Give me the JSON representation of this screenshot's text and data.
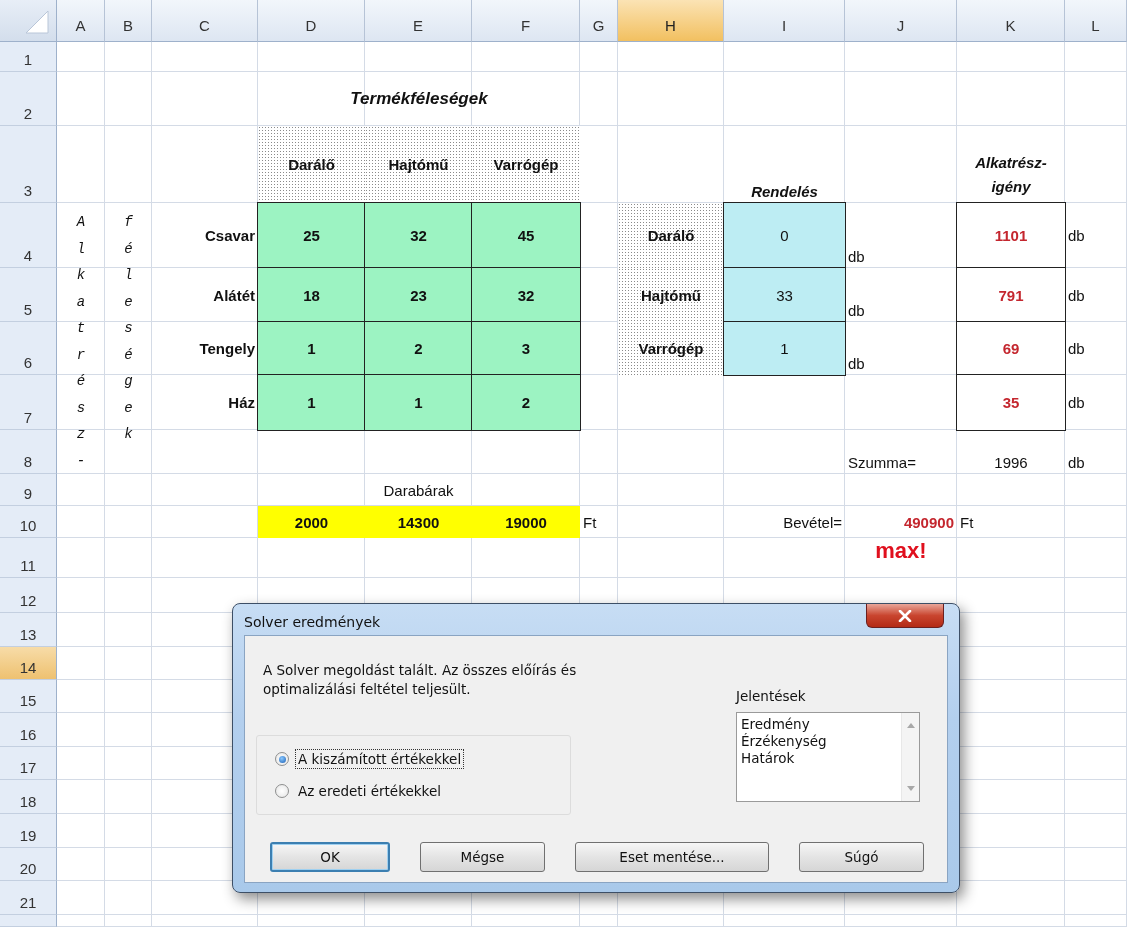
{
  "spreadsheet": {
    "columns": [
      {
        "label": "A",
        "selected": false
      },
      {
        "label": "B",
        "selected": false
      },
      {
        "label": "C",
        "selected": false
      },
      {
        "label": "D",
        "selected": false
      },
      {
        "label": "E",
        "selected": false
      },
      {
        "label": "F",
        "selected": false
      },
      {
        "label": "G",
        "selected": false
      },
      {
        "label": "H",
        "selected": true
      },
      {
        "label": "I",
        "selected": false
      },
      {
        "label": "J",
        "selected": false
      },
      {
        "label": "K",
        "selected": false
      },
      {
        "label": "L",
        "selected": false
      }
    ],
    "rows": [
      {
        "label": "1",
        "selected": false
      },
      {
        "label": "2",
        "selected": false
      },
      {
        "label": "3",
        "selected": false
      },
      {
        "label": "4",
        "selected": false
      },
      {
        "label": "5",
        "selected": false
      },
      {
        "label": "6",
        "selected": false
      },
      {
        "label": "7",
        "selected": false
      },
      {
        "label": "8",
        "selected": false
      },
      {
        "label": "9",
        "selected": false
      },
      {
        "label": "10",
        "selected": false
      },
      {
        "label": "11",
        "selected": false
      },
      {
        "label": "12",
        "selected": false
      },
      {
        "label": "13",
        "selected": false
      },
      {
        "label": "14",
        "selected": true
      },
      {
        "label": "15",
        "selected": false
      },
      {
        "label": "16",
        "selected": false
      },
      {
        "label": "17",
        "selected": false
      },
      {
        "label": "18",
        "selected": false
      },
      {
        "label": "19",
        "selected": false
      },
      {
        "label": "20",
        "selected": false
      },
      {
        "label": "21",
        "selected": false
      }
    ]
  },
  "title": "Termékféleségek",
  "side_labels": [
    "Alkatrész-",
    "féleségek"
  ],
  "products": [
    "Darálő",
    "Hajtómű",
    "Varrógép"
  ],
  "parts": [
    {
      "name": "Csavar",
      "amounts": [
        "25",
        "32",
        "45"
      ],
      "demand": "1101",
      "unit": "db"
    },
    {
      "name": "Alátét",
      "amounts": [
        "18",
        "23",
        "32"
      ],
      "demand": "791",
      "unit": "db"
    },
    {
      "name": "Tengely",
      "amounts": [
        "1",
        "2",
        "3"
      ],
      "demand": "69",
      "unit": "db"
    },
    {
      "name": "Ház",
      "amounts": [
        "1",
        "1",
        "2"
      ],
      "demand": "35",
      "unit": "db"
    }
  ],
  "order": {
    "label": "Rendelés",
    "items": [
      {
        "product": "Darálő",
        "quantity": "0",
        "unit": "db"
      },
      {
        "product": "Hajtómű",
        "quantity": "33",
        "unit": "db"
      },
      {
        "product": "Varrógép",
        "quantity": "1",
        "unit": "db"
      }
    ]
  },
  "demand_label": [
    "Alkatrész-",
    "igény"
  ],
  "sum": {
    "label": "Szumma=",
    "value": "1996",
    "unit": "db"
  },
  "prices": {
    "label": "Darabárak",
    "values": [
      "2000",
      "14300",
      "19000"
    ],
    "unit": "Ft"
  },
  "revenue": {
    "label": "Bevétel=",
    "value": "490900",
    "unit": "Ft",
    "goal": "max!"
  },
  "dialog": {
    "title": "Solver eredmények",
    "message": "A Solver megoldást talált. Az összes előírás és optimalizálási feltétel teljesült.",
    "options": [
      {
        "label": "A kiszámított értékekkel",
        "selected": true
      },
      {
        "label": "Az eredeti értékekkel",
        "selected": false
      }
    ],
    "reports_label": "Jelentések",
    "reports": [
      "Eredmény",
      "Érzékenység",
      "Határok"
    ],
    "buttons": [
      {
        "label": "OK",
        "default": true
      },
      {
        "label": "Mégse",
        "default": false
      },
      {
        "label": "Eset mentése...",
        "default": false
      },
      {
        "label": "Súgó",
        "default": false
      }
    ]
  }
}
